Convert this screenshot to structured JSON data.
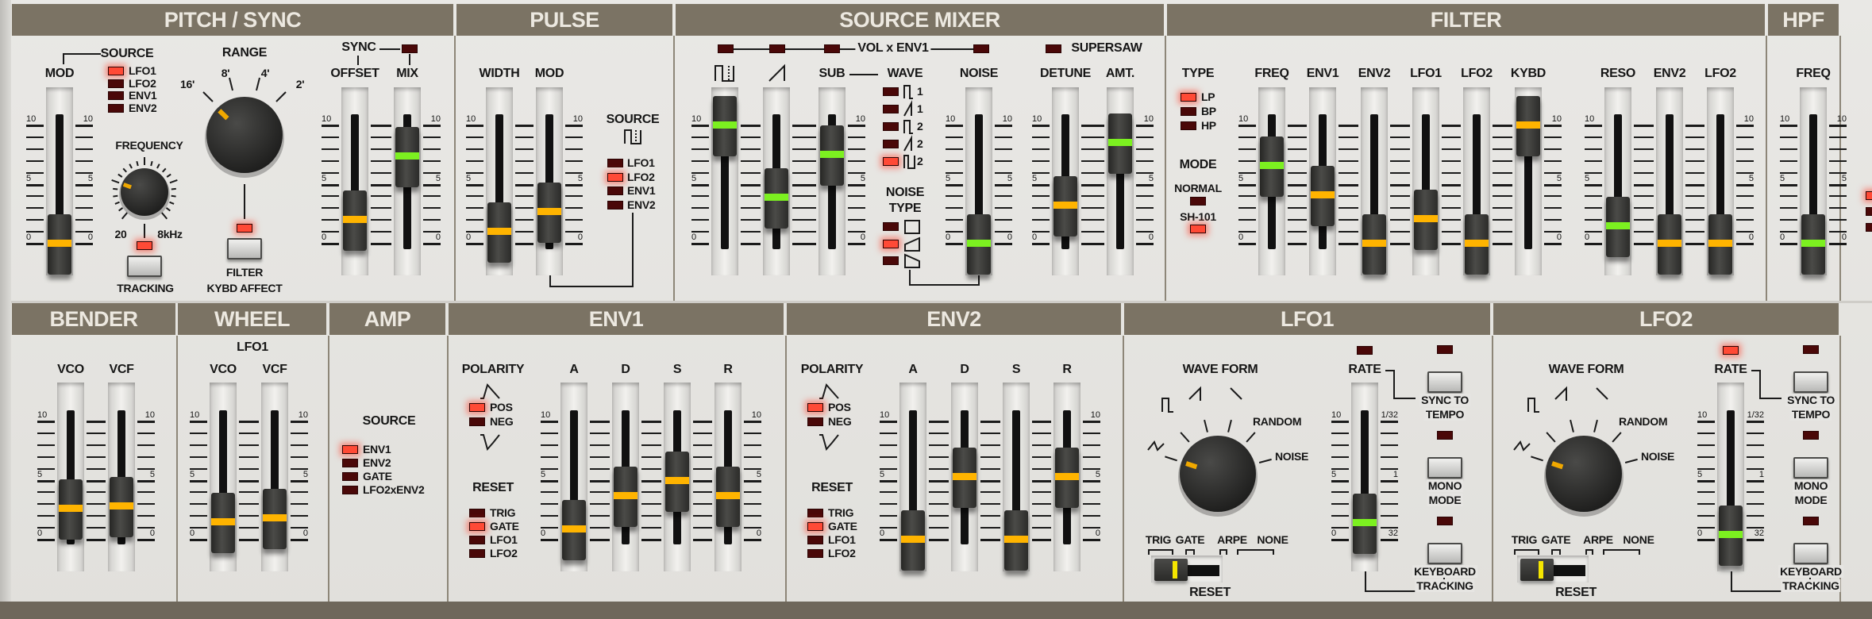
{
  "colors": {
    "header": "#7b7364",
    "panel": "#e6e5e2",
    "led_on": "#ff4a36",
    "led_off": "#4a0808",
    "slider_green": "#7cf020",
    "slider_amber": "#ffb400"
  },
  "scale": {
    "max": "10",
    "mid": "5",
    "min": "0"
  },
  "pitch_sync": {
    "title": "PITCH / SYNC",
    "source_label": "SOURCE",
    "source_leds": [
      {
        "label": "LFO1",
        "on": true
      },
      {
        "label": "LFO2",
        "on": false
      },
      {
        "label": "ENV1",
        "on": false
      },
      {
        "label": "ENV2",
        "on": false
      }
    ],
    "range": {
      "label": "RANGE",
      "ticks": [
        "16'",
        "8'",
        "4'",
        "2'"
      ],
      "selected": 0
    },
    "frequency": {
      "label": "FREQUENCY",
      "min": "20",
      "max": "8kHz",
      "value": 0.25
    },
    "tracking": {
      "label": "TRACKING",
      "on": true
    },
    "filter_kybd": {
      "line1": "FILTER",
      "line2": "KYBD AFFECT",
      "on": true
    },
    "sync": {
      "label": "SYNC",
      "on": false
    },
    "sliders": [
      {
        "label": "MOD",
        "value": 0,
        "led": "amber"
      },
      {
        "label": "OFFSET",
        "value": 2,
        "led": "amber"
      },
      {
        "label": "MIX",
        "value": 7.4,
        "led": "green"
      }
    ]
  },
  "pulse": {
    "title": "PULSE",
    "source_label": "SOURCE",
    "source_icon": "pulse-width-icon",
    "source_leds": [
      {
        "label": "LFO1",
        "on": false
      },
      {
        "label": "LFO2",
        "on": true
      },
      {
        "label": "ENV1",
        "on": false
      },
      {
        "label": "ENV2",
        "on": false
      }
    ],
    "sliders": [
      {
        "label": "WIDTH",
        "value": 1,
        "led": "amber"
      },
      {
        "label": "MOD",
        "value": 2.7,
        "led": "amber"
      }
    ]
  },
  "mixer": {
    "title": "SOURCE MIXER",
    "vol_env_label": "VOL x ENV1",
    "vol_env_leds": [
      false,
      false,
      false,
      false
    ],
    "supersaw": {
      "label": "SUPERSAW",
      "on": false
    },
    "wave_label": "WAVE",
    "noise_type_label1": "NOISE",
    "noise_type_label2": "TYPE",
    "wave_leds": [
      {
        "icon": "square",
        "num": "1",
        "on": false
      },
      {
        "icon": "saw",
        "num": "1",
        "on": false
      },
      {
        "icon": "square",
        "num": "2",
        "on": false
      },
      {
        "icon": "saw",
        "num": "2",
        "on": false
      },
      {
        "icon": "pulse",
        "num": "2",
        "on": true
      }
    ],
    "noise_leds": [
      {
        "icon": "white-noise",
        "on": false
      },
      {
        "icon": "pink-noise",
        "on": true
      },
      {
        "icon": "brown-noise",
        "on": false
      }
    ],
    "sliders": [
      {
        "label": "",
        "icon": "pulse-wave",
        "value": 10,
        "led": "green"
      },
      {
        "label": "",
        "icon": "saw-wave",
        "value": 3.9,
        "led": "green"
      },
      {
        "label": "SUB",
        "value": 7.5,
        "led": "green"
      },
      {
        "label": "NOISE",
        "value": 0,
        "led": "green"
      },
      {
        "label": "DETUNE",
        "value": 3.2,
        "led": "amber"
      },
      {
        "label": "AMT.",
        "value": 8.5,
        "led": "green"
      }
    ]
  },
  "filter": {
    "title": "FILTER",
    "type_label": "TYPE",
    "type_leds": [
      {
        "label": "LP",
        "on": true
      },
      {
        "label": "BP",
        "on": false
      },
      {
        "label": "HP",
        "on": false
      }
    ],
    "mode_label": "MODE",
    "mode_normal": {
      "label": "NORMAL",
      "on": false
    },
    "mode_sh101": {
      "label": "SH-101",
      "on": true
    },
    "sliders": [
      {
        "label": "FREQ",
        "value": 6.6,
        "led": "green"
      },
      {
        "label": "ENV1",
        "value": 4.1,
        "led": "amber"
      },
      {
        "label": "ENV2",
        "value": 0,
        "led": "amber"
      },
      {
        "label": "LFO1",
        "value": 2.1,
        "led": "amber"
      },
      {
        "label": "LFO2",
        "value": 0,
        "led": "amber"
      },
      {
        "label": "KYBD",
        "value": 10,
        "led": "amber"
      },
      {
        "label": "RESO",
        "value": 1.5,
        "led": "green"
      },
      {
        "label": "ENV2",
        "value": 0,
        "led": "amber"
      },
      {
        "label": "LFO2",
        "value": 0,
        "led": "amber"
      }
    ]
  },
  "hpf": {
    "title": "HPF",
    "sliders": [
      {
        "label": "FREQ",
        "value": 0,
        "led": "green"
      }
    ]
  },
  "bender": {
    "title": "BENDER",
    "sliders": [
      {
        "label": "VCO",
        "value": 2.6,
        "led": "amber"
      },
      {
        "label": "VCF",
        "value": 2.8,
        "led": "amber"
      }
    ]
  },
  "wheel": {
    "title": "WHEEL",
    "sub_label": "LFO1",
    "sliders": [
      {
        "label": "VCO",
        "value": 1.5,
        "led": "amber"
      },
      {
        "label": "VCF",
        "value": 1.8,
        "led": "amber"
      }
    ]
  },
  "amp": {
    "title": "AMP",
    "source_label": "SOURCE",
    "source_leds": [
      {
        "label": "ENV1",
        "on": true
      },
      {
        "label": "ENV2",
        "on": false
      },
      {
        "label": "GATE",
        "on": false
      },
      {
        "label": "LFO2xENV2",
        "on": false
      }
    ]
  },
  "env1": {
    "title": "ENV1",
    "polarity_label": "POLARITY",
    "polarity_leds": [
      {
        "label": "POS",
        "on": true
      },
      {
        "label": "NEG",
        "on": false
      }
    ],
    "reset_label": "RESET",
    "reset_leds": [
      {
        "label": "TRIG",
        "on": false
      },
      {
        "label": "GATE",
        "on": true
      },
      {
        "label": "LFO1",
        "on": false
      },
      {
        "label": "LFO2",
        "on": false
      }
    ],
    "sliders": [
      {
        "label": "A",
        "value": 0.9,
        "led": "amber"
      },
      {
        "label": "D",
        "value": 3.7,
        "led": "amber"
      },
      {
        "label": "S",
        "value": 5,
        "led": "amber"
      },
      {
        "label": "R",
        "value": 3.7,
        "led": "amber"
      }
    ]
  },
  "env2": {
    "title": "ENV2",
    "polarity_label": "POLARITY",
    "polarity_leds": [
      {
        "label": "POS",
        "on": true
      },
      {
        "label": "NEG",
        "on": false
      }
    ],
    "reset_label": "RESET",
    "reset_leds": [
      {
        "label": "TRIG",
        "on": false
      },
      {
        "label": "GATE",
        "on": true
      },
      {
        "label": "LFO1",
        "on": false
      },
      {
        "label": "LFO2",
        "on": false
      }
    ],
    "sliders": [
      {
        "label": "A",
        "value": 0,
        "led": "amber"
      },
      {
        "label": "D",
        "value": 5.3,
        "led": "amber"
      },
      {
        "label": "S",
        "value": 0,
        "led": "amber"
      },
      {
        "label": "R",
        "value": 5.3,
        "led": "amber"
      }
    ]
  },
  "lfo1": {
    "title": "LFO1",
    "waveform_label": "WAVE FORM",
    "waveforms": [
      "triangle",
      "square",
      "saw-up",
      "saw-down",
      "RANDOM",
      "NOISE"
    ],
    "selected_waveform": 0,
    "reset_options": [
      "TRIG",
      "GATE",
      "ARPE",
      "NONE"
    ],
    "reset_selected": "GATE",
    "reset_label": "RESET",
    "rate": {
      "label": "RATE",
      "value": 1.4,
      "led": "green",
      "led_on": false,
      "right_scale": [
        "1/32",
        "1",
        "32"
      ]
    },
    "sync_to_tempo": {
      "line1": "SYNC TO",
      "line2": "TEMPO",
      "on": false
    },
    "mono_mode": {
      "line1": "MONO",
      "line2": "MODE",
      "on": false
    },
    "keyboard_tracking": {
      "line1": "KEYBOARD",
      "line2": "TRACKING",
      "on": false
    }
  },
  "lfo2": {
    "title": "LFO2",
    "waveform_label": "WAVE FORM",
    "waveforms": [
      "triangle",
      "square",
      "saw-up",
      "saw-down",
      "RANDOM",
      "NOISE"
    ],
    "selected_waveform": 0,
    "reset_options": [
      "TRIG",
      "GATE",
      "ARPE",
      "NONE"
    ],
    "reset_selected": "GATE",
    "reset_label": "RESET",
    "rate": {
      "label": "RATE",
      "value": 0.4,
      "led": "green",
      "led_on": true,
      "right_scale": [
        "1/32",
        "1",
        "32"
      ]
    },
    "sync_to_tempo": {
      "line1": "SYNC TO",
      "line2": "TEMPO",
      "on": false
    },
    "mono_mode": {
      "line1": "MONO",
      "line2": "MODE",
      "on": false
    },
    "keyboard_tracking": {
      "line1": "KEYBOARD",
      "line2": "TRACKING",
      "on": false
    }
  }
}
